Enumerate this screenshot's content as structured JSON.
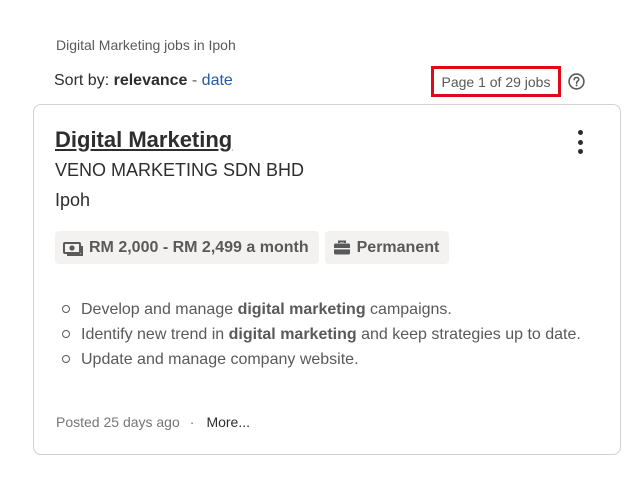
{
  "search": {
    "title": "Digital Marketing jobs in Ipoh"
  },
  "sort": {
    "label": "Sort by:",
    "active": "relevance",
    "separator": "-",
    "alternate": "date"
  },
  "pagination": {
    "text": "Page 1 of 29 jobs"
  },
  "job": {
    "title": "Digital Marketing",
    "company": "VENO MARKETING SDN BHD",
    "location": "Ipoh",
    "salary": "RM 2,000 - RM 2,499 a month",
    "job_type": "Permanent",
    "snippet": [
      {
        "pre": "Develop and manage ",
        "bold": "digital marketing",
        "post": " campaigns."
      },
      {
        "pre": "Identify new trend in ",
        "bold": "digital marketing",
        "post": " and keep strategies up to date."
      },
      {
        "pre": "Update and manage company website.",
        "bold": "",
        "post": ""
      }
    ],
    "posted": "Posted 25 days ago",
    "dot": "·",
    "more": "More..."
  },
  "colors": {
    "highlight_border": "#e0091a",
    "link": "#2557a7",
    "tag_bg": "#f3f2f1"
  },
  "icons": {
    "help": "question-circle-icon",
    "menu": "kebab-menu-icon",
    "salary": "money-icon",
    "job_type": "briefcase-icon"
  }
}
